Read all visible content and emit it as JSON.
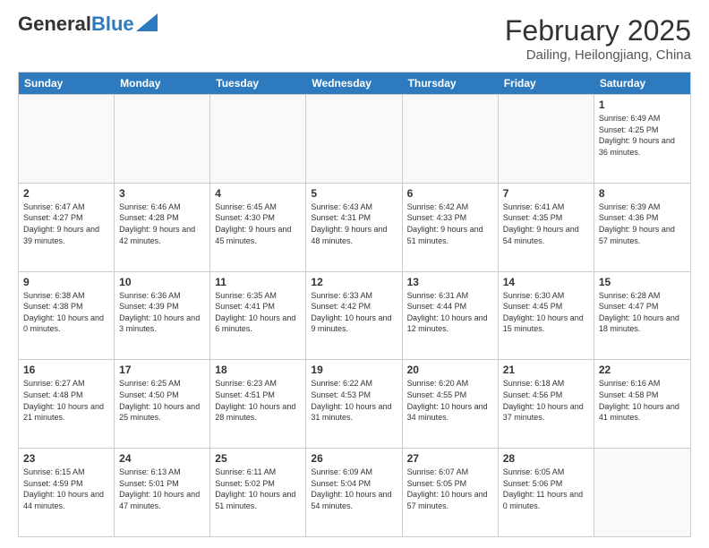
{
  "logo": {
    "general": "General",
    "blue": "Blue"
  },
  "header": {
    "month": "February 2025",
    "location": "Dailing, Heilongjiang, China"
  },
  "weekdays": [
    "Sunday",
    "Monday",
    "Tuesday",
    "Wednesday",
    "Thursday",
    "Friday",
    "Saturday"
  ],
  "weeks": [
    [
      {
        "day": "",
        "info": "",
        "empty": true
      },
      {
        "day": "",
        "info": "",
        "empty": true
      },
      {
        "day": "",
        "info": "",
        "empty": true
      },
      {
        "day": "",
        "info": "",
        "empty": true
      },
      {
        "day": "",
        "info": "",
        "empty": true
      },
      {
        "day": "",
        "info": "",
        "empty": true
      },
      {
        "day": "1",
        "info": "Sunrise: 6:49 AM\nSunset: 4:25 PM\nDaylight: 9 hours and 36 minutes."
      }
    ],
    [
      {
        "day": "2",
        "info": "Sunrise: 6:47 AM\nSunset: 4:27 PM\nDaylight: 9 hours and 39 minutes."
      },
      {
        "day": "3",
        "info": "Sunrise: 6:46 AM\nSunset: 4:28 PM\nDaylight: 9 hours and 42 minutes."
      },
      {
        "day": "4",
        "info": "Sunrise: 6:45 AM\nSunset: 4:30 PM\nDaylight: 9 hours and 45 minutes."
      },
      {
        "day": "5",
        "info": "Sunrise: 6:43 AM\nSunset: 4:31 PM\nDaylight: 9 hours and 48 minutes."
      },
      {
        "day": "6",
        "info": "Sunrise: 6:42 AM\nSunset: 4:33 PM\nDaylight: 9 hours and 51 minutes."
      },
      {
        "day": "7",
        "info": "Sunrise: 6:41 AM\nSunset: 4:35 PM\nDaylight: 9 hours and 54 minutes."
      },
      {
        "day": "8",
        "info": "Sunrise: 6:39 AM\nSunset: 4:36 PM\nDaylight: 9 hours and 57 minutes."
      }
    ],
    [
      {
        "day": "9",
        "info": "Sunrise: 6:38 AM\nSunset: 4:38 PM\nDaylight: 10 hours and 0 minutes."
      },
      {
        "day": "10",
        "info": "Sunrise: 6:36 AM\nSunset: 4:39 PM\nDaylight: 10 hours and 3 minutes."
      },
      {
        "day": "11",
        "info": "Sunrise: 6:35 AM\nSunset: 4:41 PM\nDaylight: 10 hours and 6 minutes."
      },
      {
        "day": "12",
        "info": "Sunrise: 6:33 AM\nSunset: 4:42 PM\nDaylight: 10 hours and 9 minutes."
      },
      {
        "day": "13",
        "info": "Sunrise: 6:31 AM\nSunset: 4:44 PM\nDaylight: 10 hours and 12 minutes."
      },
      {
        "day": "14",
        "info": "Sunrise: 6:30 AM\nSunset: 4:45 PM\nDaylight: 10 hours and 15 minutes."
      },
      {
        "day": "15",
        "info": "Sunrise: 6:28 AM\nSunset: 4:47 PM\nDaylight: 10 hours and 18 minutes."
      }
    ],
    [
      {
        "day": "16",
        "info": "Sunrise: 6:27 AM\nSunset: 4:48 PM\nDaylight: 10 hours and 21 minutes."
      },
      {
        "day": "17",
        "info": "Sunrise: 6:25 AM\nSunset: 4:50 PM\nDaylight: 10 hours and 25 minutes."
      },
      {
        "day": "18",
        "info": "Sunrise: 6:23 AM\nSunset: 4:51 PM\nDaylight: 10 hours and 28 minutes."
      },
      {
        "day": "19",
        "info": "Sunrise: 6:22 AM\nSunset: 4:53 PM\nDaylight: 10 hours and 31 minutes."
      },
      {
        "day": "20",
        "info": "Sunrise: 6:20 AM\nSunset: 4:55 PM\nDaylight: 10 hours and 34 minutes."
      },
      {
        "day": "21",
        "info": "Sunrise: 6:18 AM\nSunset: 4:56 PM\nDaylight: 10 hours and 37 minutes."
      },
      {
        "day": "22",
        "info": "Sunrise: 6:16 AM\nSunset: 4:58 PM\nDaylight: 10 hours and 41 minutes."
      }
    ],
    [
      {
        "day": "23",
        "info": "Sunrise: 6:15 AM\nSunset: 4:59 PM\nDaylight: 10 hours and 44 minutes."
      },
      {
        "day": "24",
        "info": "Sunrise: 6:13 AM\nSunset: 5:01 PM\nDaylight: 10 hours and 47 minutes."
      },
      {
        "day": "25",
        "info": "Sunrise: 6:11 AM\nSunset: 5:02 PM\nDaylight: 10 hours and 51 minutes."
      },
      {
        "day": "26",
        "info": "Sunrise: 6:09 AM\nSunset: 5:04 PM\nDaylight: 10 hours and 54 minutes."
      },
      {
        "day": "27",
        "info": "Sunrise: 6:07 AM\nSunset: 5:05 PM\nDaylight: 10 hours and 57 minutes."
      },
      {
        "day": "28",
        "info": "Sunrise: 6:05 AM\nSunset: 5:06 PM\nDaylight: 11 hours and 0 minutes."
      },
      {
        "day": "",
        "info": "",
        "empty": true
      }
    ]
  ]
}
